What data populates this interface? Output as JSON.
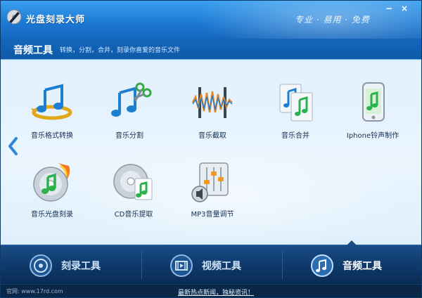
{
  "app": {
    "title": "光盘刻录大师",
    "slogan": "专业 · 易用 · 免费"
  },
  "window_controls": {
    "minimize": "−",
    "close": "×"
  },
  "section": {
    "title": "音频工具",
    "description": "转换，分割，合并，刻录你喜爱的音乐文件"
  },
  "tools": [
    {
      "label": "音乐格式转换",
      "icon": "music-convert-icon"
    },
    {
      "label": "音乐分割",
      "icon": "music-split-icon"
    },
    {
      "label": "音乐截取",
      "icon": "music-trim-icon"
    },
    {
      "label": "音乐合并",
      "icon": "music-merge-icon"
    },
    {
      "label": "Iphone铃声制作",
      "icon": "iphone-ringtone-icon"
    },
    {
      "label": "音乐光盘刻录",
      "icon": "music-disc-burn-icon"
    },
    {
      "label": "CD音乐提取",
      "icon": "cd-extract-icon"
    },
    {
      "label": "MP3音量调节",
      "icon": "mp3-volume-icon"
    }
  ],
  "nav": [
    {
      "label": "刻录工具",
      "icon": "burn-disc-icon",
      "active": false
    },
    {
      "label": "视频工具",
      "icon": "film-icon",
      "active": false
    },
    {
      "label": "音频工具",
      "icon": "music-note-icon",
      "active": true
    }
  ],
  "status": {
    "site": "官网: www.17rd.com",
    "news": "最新热点新闻，独秘资讯！"
  },
  "colors": {
    "titlebar": "#1b78d3",
    "bottombar": "#0f3a6c",
    "accent": "#2fa9ec",
    "icon_green": "#2bb24c"
  }
}
